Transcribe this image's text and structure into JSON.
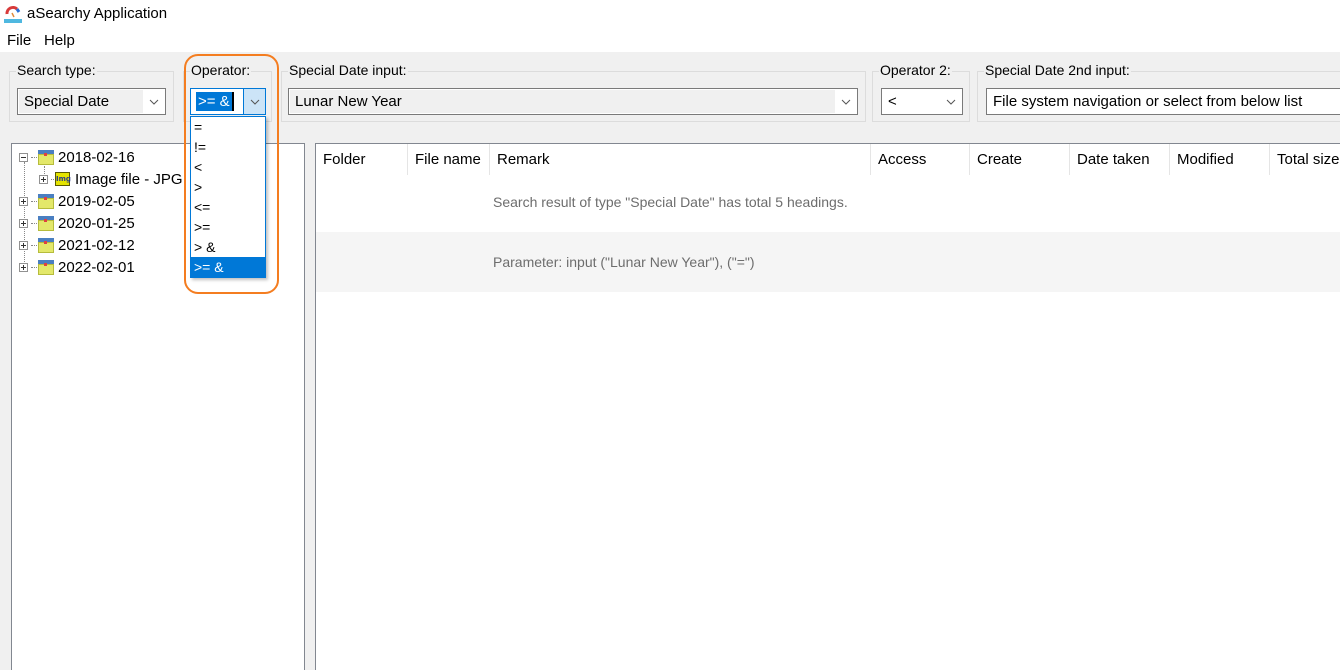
{
  "window": {
    "title": "aSearchy Application",
    "icon": "app-logo-icon"
  },
  "menu": {
    "items": [
      "File",
      "Help"
    ]
  },
  "search_type": {
    "label": "Search type:",
    "value": "Special Date"
  },
  "operator": {
    "label": "Operator:",
    "value": ">= &",
    "options": [
      "=",
      "!=",
      "<",
      ">",
      "<=",
      ">=",
      "> &",
      ">= &"
    ],
    "selected_index": 7,
    "dropdown_open": true
  },
  "special_date_input": {
    "label": "Special Date input:",
    "value": "Lunar New Year"
  },
  "operator2": {
    "label": "Operator 2:",
    "value": "<"
  },
  "special_date_2nd_input": {
    "label": "Special Date 2nd input:",
    "placeholder": "File system navigation or select from below list"
  },
  "tree": {
    "nodes": [
      {
        "label": "2018-02-16",
        "expanded": true,
        "icon": "calendar-icon",
        "children": [
          {
            "label": "Image file - JPG",
            "icon": "jpg-file-icon",
            "expanded": false
          }
        ]
      },
      {
        "label": "2019-02-05",
        "expanded": false,
        "icon": "calendar-icon"
      },
      {
        "label": "2020-01-25",
        "expanded": false,
        "icon": "calendar-icon"
      },
      {
        "label": "2021-02-12",
        "expanded": false,
        "icon": "calendar-icon"
      },
      {
        "label": "2022-02-01",
        "expanded": false,
        "icon": "calendar-icon"
      }
    ]
  },
  "results": {
    "columns": [
      "Folder",
      "File name",
      "Remark",
      "Access",
      "Create",
      "Date taken",
      "Modified",
      "Total size"
    ],
    "rows": [
      {
        "remark": "Search result of type \"Special Date\" has total 5 headings."
      },
      {
        "remark": "Parameter: input (\"Lunar New Year\"), (\"=\")"
      }
    ]
  },
  "colors": {
    "accent": "#0078d7",
    "highlight_outline": "#f47d20",
    "window_bg": "#f0f0f0"
  }
}
